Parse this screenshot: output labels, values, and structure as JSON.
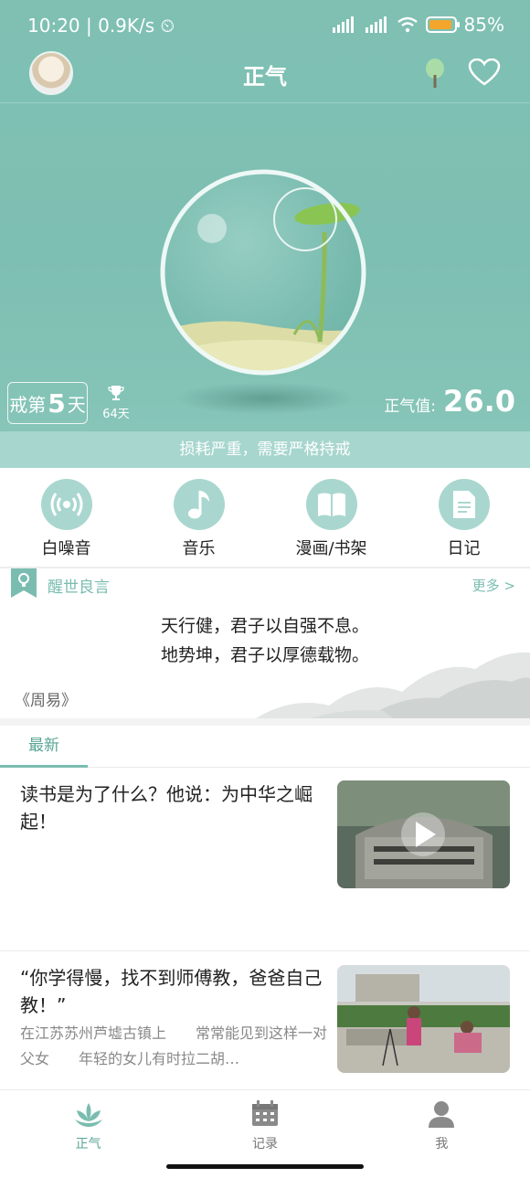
{
  "status_bar": {
    "time": "10:20",
    "speed": "0.9K/s",
    "battery": "85%"
  },
  "header": {
    "title": "正气"
  },
  "hero": {
    "days_prefix": "戒第",
    "days_num": "5",
    "days_suffix": "天",
    "record_days": "64天",
    "energy_label": "正气值:",
    "energy_value": "26.0"
  },
  "warning": "损耗严重，需要严格持戒",
  "tools": [
    {
      "label": "白噪音",
      "icon": "radio-waves-icon"
    },
    {
      "label": "音乐",
      "icon": "music-note-icon"
    },
    {
      "label": "漫画/书架",
      "icon": "book-icon"
    },
    {
      "label": "日记",
      "icon": "document-icon"
    }
  ],
  "quote": {
    "title": "醒世良言",
    "more": "更多 >",
    "line1": "天行健，君子以自强不息。",
    "line2": "地势坤，君子以厚德载物。",
    "source": "《周易》"
  },
  "tabs": {
    "latest": "最新"
  },
  "articles": [
    {
      "title": "读书是为了什么？他说：为中华之崛起！",
      "desc": ""
    },
    {
      "title": "“你学得慢，找不到师傅教，爸爸自己教！”",
      "desc": "在江苏苏州芦墟古镇上　　常常能见到这样一对父女　　年轻的女儿有时拉二胡…"
    }
  ],
  "bottom_nav": [
    {
      "label": "正气",
      "icon": "lotus-icon"
    },
    {
      "label": "记录",
      "icon": "calendar-icon"
    },
    {
      "label": "我",
      "icon": "person-icon"
    }
  ],
  "colors": {
    "primary": "#7dbfb2",
    "accent": "#5aa595",
    "light": "#a9d7cf"
  }
}
